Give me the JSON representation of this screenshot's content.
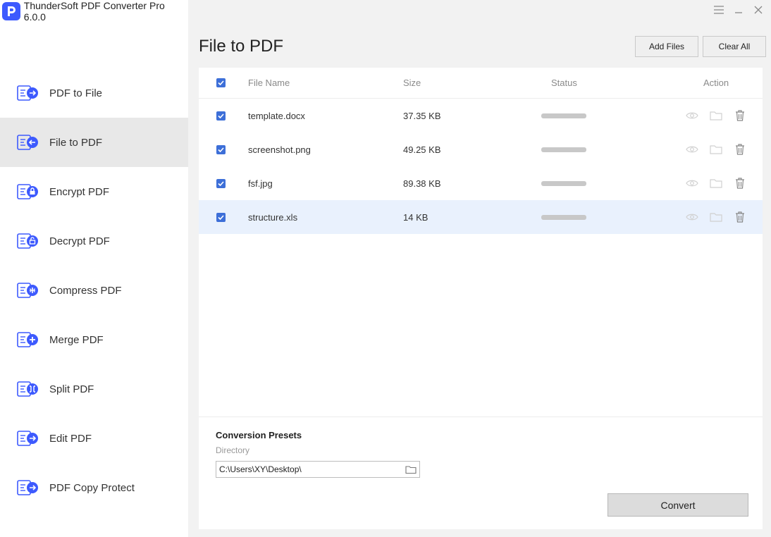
{
  "app": {
    "title": "ThunderSoft PDF Converter Pro 6.0.0"
  },
  "colors": {
    "accent": "#3d5afe",
    "checkbox": "#3d6fd8",
    "active_nav": "#e8e8e8",
    "selected_row": "#e9f1fd"
  },
  "sidebar": {
    "items": [
      {
        "label": "PDF to File",
        "icon": "file-arrow-right-icon"
      },
      {
        "label": "File to PDF",
        "icon": "file-arrow-left-icon"
      },
      {
        "label": "Encrypt PDF",
        "icon": "file-lock-icon"
      },
      {
        "label": "Decrypt PDF",
        "icon": "file-unlock-icon"
      },
      {
        "label": "Compress PDF",
        "icon": "file-compress-icon"
      },
      {
        "label": "Merge PDF",
        "icon": "file-merge-icon"
      },
      {
        "label": "Split PDF",
        "icon": "file-split-icon"
      },
      {
        "label": "Edit PDF",
        "icon": "file-edit-icon"
      },
      {
        "label": "PDF Copy Protect",
        "icon": "file-protect-icon"
      }
    ],
    "active_index": 1
  },
  "main": {
    "title": "File to PDF",
    "add_files_label": "Add Files",
    "clear_all_label": "Clear All"
  },
  "table": {
    "headers": {
      "name": "File Name",
      "size": "Size",
      "status": "Status",
      "action": "Action"
    },
    "rows": [
      {
        "name": "template.docx",
        "size": "37.35 KB",
        "checked": true
      },
      {
        "name": "screenshot.png",
        "size": "49.25 KB",
        "checked": true
      },
      {
        "name": "fsf.jpg",
        "size": "89.38 KB",
        "checked": true
      },
      {
        "name": "structure.xls",
        "size": "14 KB",
        "checked": true
      }
    ]
  },
  "presets": {
    "title": "Conversion Presets",
    "directory_label": "Directory",
    "directory_value": "C:\\Users\\XY\\Desktop\\",
    "convert_label": "Convert"
  }
}
